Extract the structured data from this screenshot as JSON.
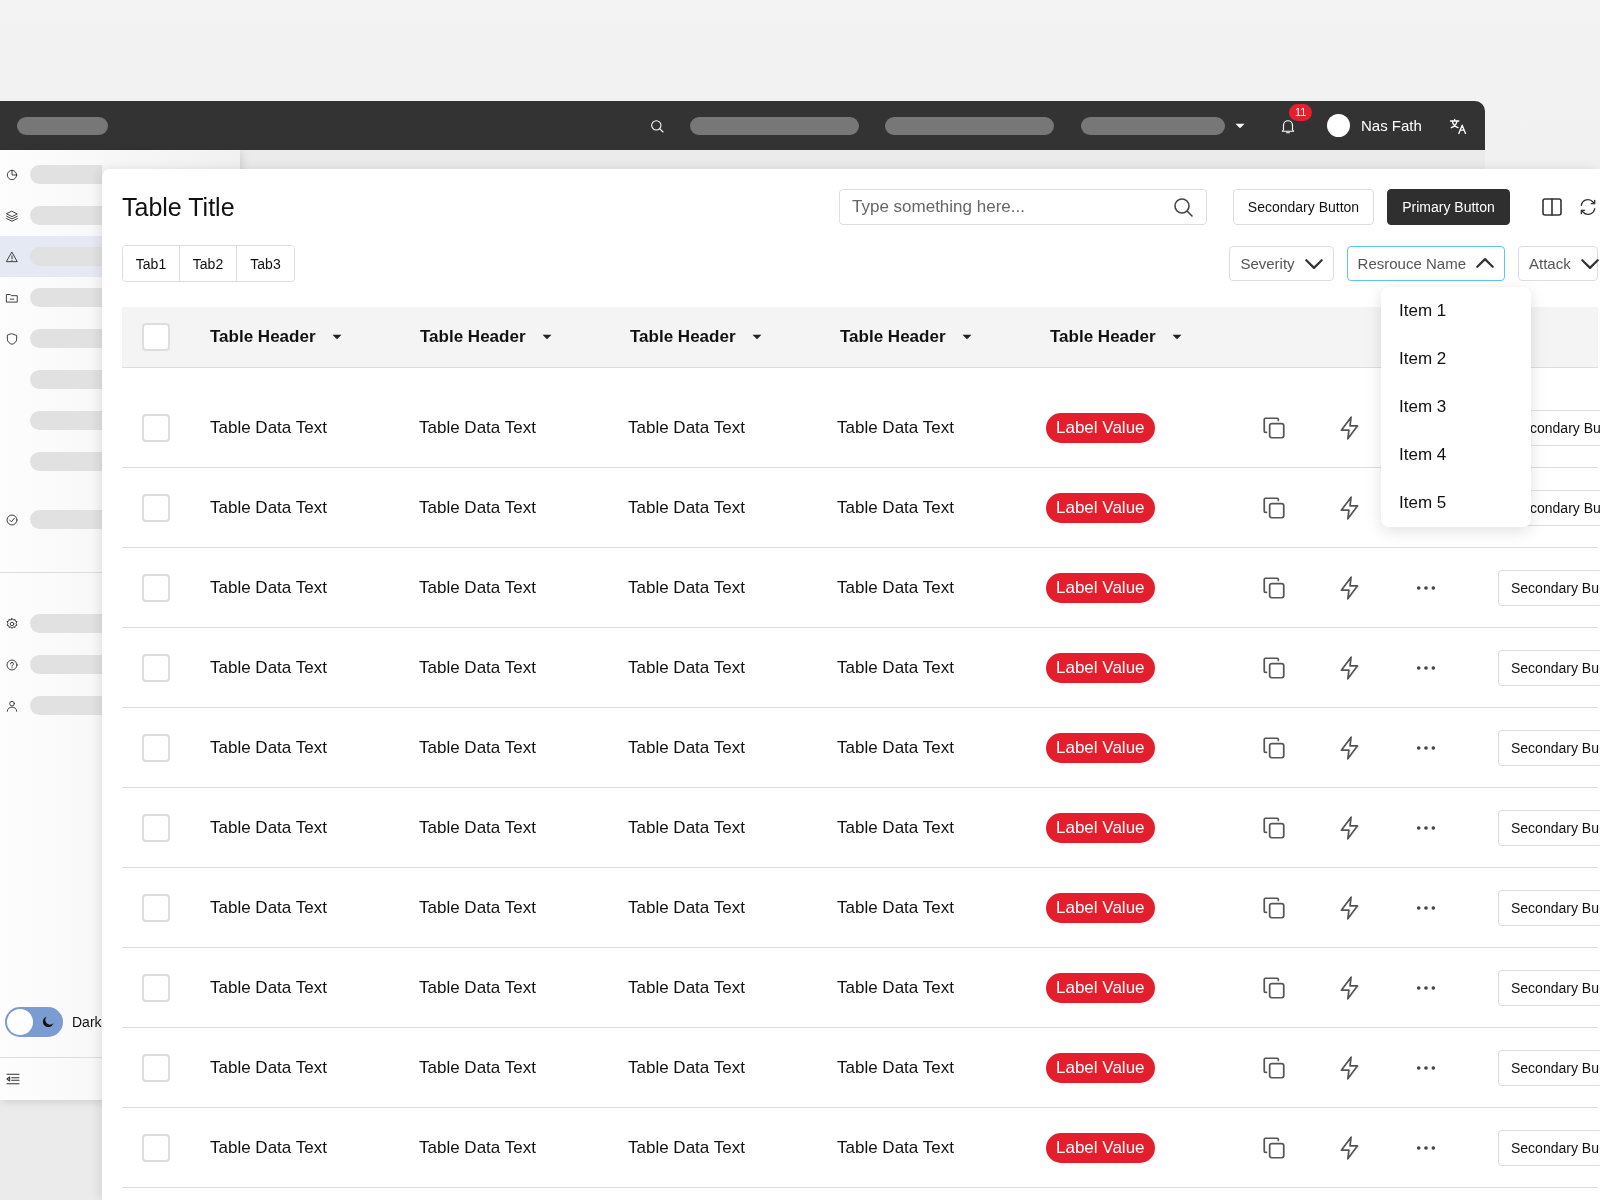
{
  "topbar": {
    "notification_count": "11",
    "user_name": "Nas Fath"
  },
  "sidebar": {
    "items": [
      {
        "selected": false
      },
      {
        "selected": false
      },
      {
        "selected": true
      },
      {
        "selected": false
      },
      {
        "selected": false,
        "children": [
          {
            "selected": false
          },
          {
            "selected": false
          },
          {
            "selected": false
          }
        ]
      },
      {
        "selected": false
      }
    ],
    "bottom_items": [
      {
        "selected": false
      },
      {
        "selected": false
      },
      {
        "selected": false
      }
    ],
    "theme_toggle": {
      "label": "Dark",
      "on": false
    }
  },
  "panel": {
    "title": "Table Title",
    "search": {
      "placeholder": "Type something here..."
    },
    "buttons": [
      {
        "label": "Secondary Button",
        "kind": "secondary"
      },
      {
        "label": "Primary Button",
        "kind": "primary"
      }
    ],
    "tabs": [
      {
        "label": "Tab1",
        "selected": false
      },
      {
        "label": "Tab2",
        "selected": false
      },
      {
        "label": "Tab3",
        "selected": false
      }
    ],
    "filters": [
      {
        "label": "Severity",
        "expanded": false
      },
      {
        "label": "Resrouce Name",
        "expanded": true
      },
      {
        "label": "Attack",
        "expanded": false
      }
    ],
    "dropdown": {
      "items": [
        "Item 1",
        "Item 2",
        "Item 3",
        "Item 4",
        "Item 5"
      ]
    },
    "table": {
      "select_all": {
        "checked": false
      },
      "columns": [
        "Table Header",
        "Table Header",
        "Table Header",
        "Table Header",
        "Table Header"
      ],
      "rows": [
        {
          "kind": "covered",
          "checked": false,
          "cells": [
            "Table Data Text",
            "Table Data Text",
            "Table Data Text",
            "Table Data Text"
          ],
          "label": "Label Value",
          "action": "condary Bu"
        },
        {
          "kind": "covered",
          "checked": false,
          "cells": [
            "Table Data Text",
            "Table Data Text",
            "Table Data Text",
            "Table Data Text"
          ],
          "label": "Label Value",
          "action": "condary Bu"
        },
        {
          "kind": "plain",
          "checked": false,
          "cells": [
            "Table Data Text",
            "Table Data Text",
            "Table Data Text",
            "Table Data Text"
          ],
          "label": "Label Value",
          "action": "Secondary Bu"
        },
        {
          "kind": "plain",
          "checked": false,
          "cells": [
            "Table Data Text",
            "Table Data Text",
            "Table Data Text",
            "Table Data Text"
          ],
          "label": "Label Value",
          "action": "Secondary Bu"
        },
        {
          "kind": "plain",
          "checked": false,
          "cells": [
            "Table Data Text",
            "Table Data Text",
            "Table Data Text",
            "Table Data Text"
          ],
          "label": "Label Value",
          "action": "Secondary Bu"
        },
        {
          "kind": "plain",
          "checked": false,
          "cells": [
            "Table Data Text",
            "Table Data Text",
            "Table Data Text",
            "Table Data Text"
          ],
          "label": "Label Value",
          "action": "Secondary Bu"
        },
        {
          "kind": "plain",
          "checked": false,
          "cells": [
            "Table Data Text",
            "Table Data Text",
            "Table Data Text",
            "Table Data Text"
          ],
          "label": "Label Value",
          "action": "Secondary Bu"
        },
        {
          "kind": "plain",
          "checked": false,
          "cells": [
            "Table Data Text",
            "Table Data Text",
            "Table Data Text",
            "Table Data Text"
          ],
          "label": "Label Value",
          "action": "Secondary Bu"
        },
        {
          "kind": "plain",
          "checked": false,
          "cells": [
            "Table Data Text",
            "Table Data Text",
            "Table Data Text",
            "Table Data Text"
          ],
          "label": "Label Value",
          "action": "Secondary Bu"
        },
        {
          "kind": "plain",
          "checked": false,
          "cells": [
            "Table Data Text",
            "Table Data Text",
            "Table Data Text",
            "Table Data Text"
          ],
          "label": "Label Value",
          "action": "Secondary Bu"
        }
      ]
    }
  }
}
